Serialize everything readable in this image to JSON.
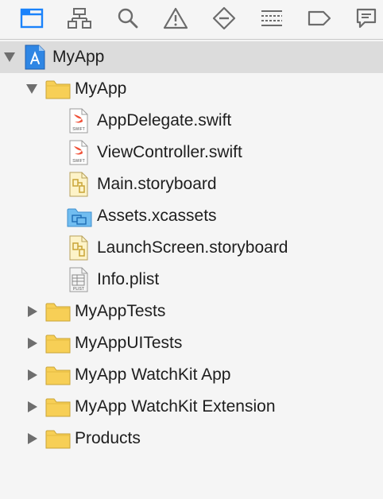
{
  "toolbar": {
    "items": [
      {
        "icon": "folder-icon",
        "active": true
      },
      {
        "icon": "hierarchy-icon",
        "active": false
      },
      {
        "icon": "search-icon",
        "active": false
      },
      {
        "icon": "warning-icon",
        "active": false
      },
      {
        "icon": "test-diamond-icon",
        "active": false
      },
      {
        "icon": "debug-list-icon",
        "active": false
      },
      {
        "icon": "breakpoint-tag-icon",
        "active": false
      },
      {
        "icon": "report-bubble-icon",
        "active": false
      }
    ],
    "active_color": "#1a82fb",
    "inactive_color": "#6c6c6c"
  },
  "tree": {
    "project": {
      "label": "MyApp",
      "icon": "xcode-project-icon",
      "expanded": true
    },
    "group_myapp": {
      "label": "MyApp",
      "icon": "folder-icon",
      "expanded": true
    },
    "files": [
      {
        "label": "AppDelegate.swift",
        "icon": "swift-file-icon",
        "badge": "SWIFT"
      },
      {
        "label": "ViewController.swift",
        "icon": "swift-file-icon",
        "badge": "SWIFT"
      },
      {
        "label": "Main.storyboard",
        "icon": "storyboard-file-icon"
      },
      {
        "label": "Assets.xcassets",
        "icon": "asset-catalog-icon"
      },
      {
        "label": "LaunchScreen.storyboard",
        "icon": "storyboard-file-icon"
      },
      {
        "label": "Info.plist",
        "icon": "plist-file-icon",
        "badge": "PLIST"
      }
    ],
    "groups": [
      {
        "label": "MyAppTests",
        "icon": "folder-icon",
        "expanded": false
      },
      {
        "label": "MyAppUITests",
        "icon": "folder-icon",
        "expanded": false
      },
      {
        "label": "MyApp WatchKit App",
        "icon": "folder-icon",
        "expanded": false
      },
      {
        "label": "MyApp WatchKit Extension",
        "icon": "folder-icon",
        "expanded": false
      },
      {
        "label": "Products",
        "icon": "folder-icon",
        "expanded": false
      }
    ]
  },
  "colors": {
    "folder_fill": "#f7cf56",
    "folder_stroke": "#c9a437",
    "swift_orange": "#f05138",
    "selection": "#dcdcdc"
  }
}
